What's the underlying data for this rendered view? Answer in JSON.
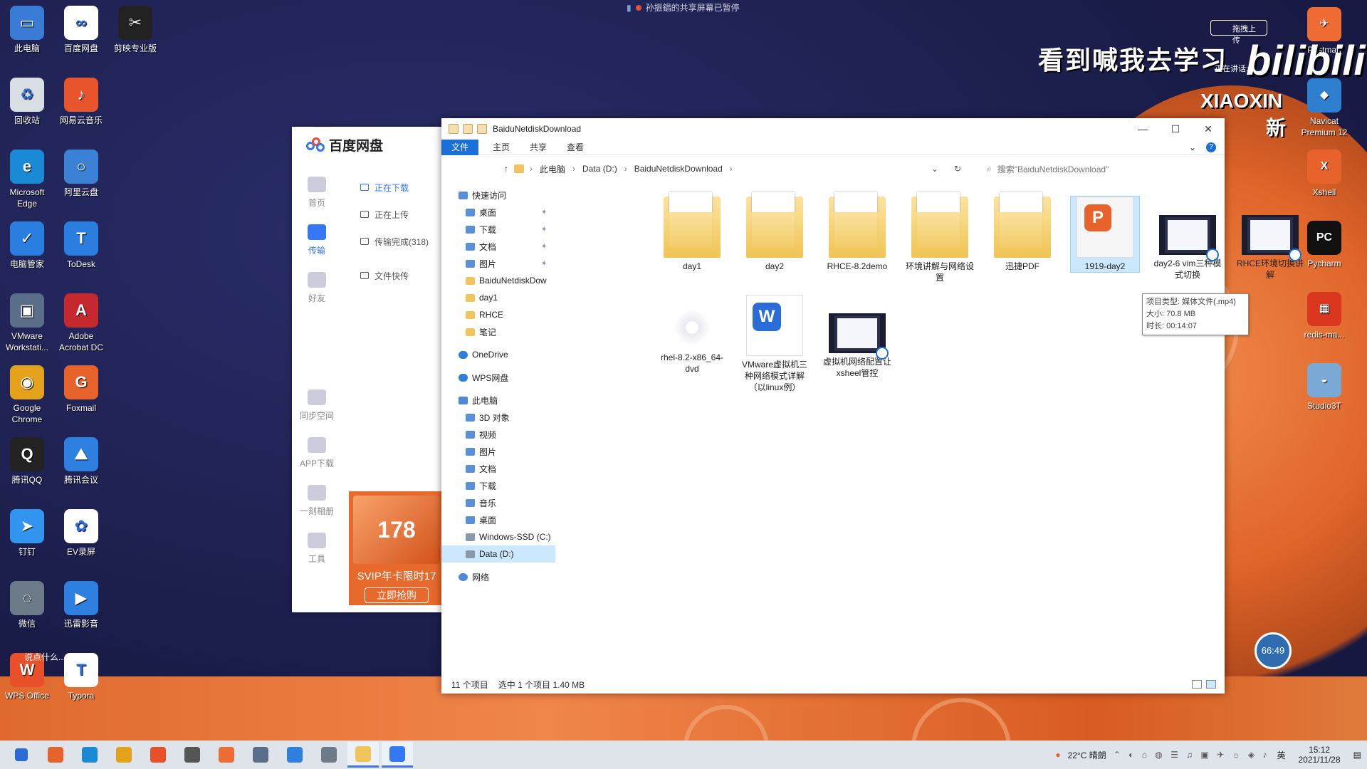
{
  "top_note": "孙振錩的共享屏幕已暂停",
  "overlay": {
    "slogan": "看到喊我去学习",
    "brand": "bilibili",
    "brand_line2": "XIAOXIN",
    "brand_line3": "新",
    "talking": "正在讲话:",
    "upload_chip": "拖拽上传",
    "timer": "66:49",
    "chat_hint": "说点什么..."
  },
  "desktop_icons": [
    {
      "label": "此电脑",
      "color": "#3a7bd5",
      "glyph": "▭"
    },
    {
      "label": "百度网盘",
      "color": "#ffffff",
      "glyph": "∞"
    },
    {
      "label": "剪映专业版",
      "color": "#222222",
      "glyph": "✂"
    },
    {
      "label": "回收站",
      "color": "#d9dde4",
      "glyph": "♻"
    },
    {
      "label": "网易云音乐",
      "color": "#e8542c",
      "glyph": "♪"
    },
    {
      "label": "Microsoft Edge",
      "color": "#1b8ad6",
      "glyph": "e"
    },
    {
      "label": "阿里云盘",
      "color": "#3b82d6",
      "glyph": "○"
    },
    {
      "label": "电脑管家",
      "color": "#2a7ee0",
      "glyph": "✓"
    },
    {
      "label": "ToDesk",
      "color": "#2a7ee0",
      "glyph": "T"
    },
    {
      "label": "VMware Workstati...",
      "color": "#5a6e8a",
      "glyph": "▣"
    },
    {
      "label": "Adobe Acrobat DC",
      "color": "#c5282e",
      "glyph": "A"
    },
    {
      "label": "Google Chrome",
      "color": "#e3a21a",
      "glyph": "◉"
    },
    {
      "label": "Foxmail",
      "color": "#e8632c",
      "glyph": "G"
    },
    {
      "label": "腾讯QQ",
      "color": "#222222",
      "glyph": "Q"
    },
    {
      "label": "腾讯会议",
      "color": "#2d7fe0",
      "glyph": "⛰"
    },
    {
      "label": "钉钉",
      "color": "#3296f0",
      "glyph": "➤"
    },
    {
      "label": "EV录屏",
      "color": "#ffffff",
      "glyph": "✿"
    },
    {
      "label": "微信",
      "color": "#6c7a8a",
      "glyph": "◌"
    },
    {
      "label": "迅雷影音",
      "color": "#2d7fe0",
      "glyph": "▶"
    },
    {
      "label": "WPS Office",
      "color": "#e8502a",
      "glyph": "W"
    },
    {
      "label": "Typora",
      "color": "#ffffff",
      "glyph": "T"
    }
  ],
  "right_icons": [
    {
      "label": "Postman",
      "color": "#ef6c35",
      "glyph": "✈"
    },
    {
      "label": "Navicat Premium 12",
      "color": "#2f7fd0",
      "glyph": "◆"
    },
    {
      "label": "Xshell",
      "color": "#e8632c",
      "glyph": "X"
    },
    {
      "label": "Pycharm",
      "color": "#111111",
      "glyph": "PC"
    },
    {
      "label": "redis-ma...",
      "color": "#d9371e",
      "glyph": "▦"
    },
    {
      "label": "Studio3T",
      "color": "#7aa9d6",
      "glyph": "◒"
    }
  ],
  "baidu": {
    "title": "百度网盘",
    "nav": [
      {
        "label": "首页"
      },
      {
        "label": "传输"
      },
      {
        "label": "好友"
      },
      {
        "label": "同步空间"
      },
      {
        "label": "APP下载"
      },
      {
        "label": "一刻相册"
      },
      {
        "label": "工具"
      }
    ],
    "sub": [
      {
        "label": "正在下载"
      },
      {
        "label": "正在上传"
      },
      {
        "label": "传输完成(318)"
      },
      {
        "label": "文件快传"
      }
    ],
    "promo_art": "178",
    "promo_text": "SVIP年卡限时17",
    "promo_button": "立即抢购"
  },
  "explorer": {
    "title": "BaiduNetdiskDownload",
    "window_controls": {
      "minimize": "—",
      "maximize": "☐",
      "close": "✕"
    },
    "ribbon_tabs": [
      "文件",
      "主页",
      "共享",
      "查看"
    ],
    "address": [
      "此电脑",
      "Data (D:)",
      "BaiduNetdiskDownload"
    ],
    "search_placeholder": "搜索\"BaiduNetdiskDownload\"",
    "nav_items": [
      {
        "label": "快速访问",
        "level": 1,
        "icon": "star",
        "pin": false
      },
      {
        "label": "桌面",
        "level": 2,
        "icon": "desktop",
        "pin": true
      },
      {
        "label": "下载",
        "level": 2,
        "icon": "download",
        "pin": true
      },
      {
        "label": "文档",
        "level": 2,
        "icon": "doc",
        "pin": true
      },
      {
        "label": "图片",
        "level": 2,
        "icon": "pic",
        "pin": true
      },
      {
        "label": "BaiduNetdiskDow",
        "level": 2,
        "icon": "folder",
        "pin": false
      },
      {
        "label": "day1",
        "level": 2,
        "icon": "folder",
        "pin": false
      },
      {
        "label": "RHCE",
        "level": 2,
        "icon": "folder",
        "pin": false
      },
      {
        "label": "笔记",
        "level": 2,
        "icon": "folder",
        "pin": false
      },
      {
        "label": "OneDrive",
        "level": 1,
        "icon": "cloud",
        "pin": false
      },
      {
        "label": "WPS网盘",
        "level": 1,
        "icon": "cloud",
        "pin": false
      },
      {
        "label": "此电脑",
        "level": 1,
        "icon": "pc",
        "pin": false
      },
      {
        "label": "3D 对象",
        "level": 2,
        "icon": "cube",
        "pin": false
      },
      {
        "label": "视频",
        "level": 2,
        "icon": "video",
        "pin": false
      },
      {
        "label": "图片",
        "level": 2,
        "icon": "pic",
        "pin": false
      },
      {
        "label": "文档",
        "level": 2,
        "icon": "doc",
        "pin": false
      },
      {
        "label": "下载",
        "level": 2,
        "icon": "download",
        "pin": false
      },
      {
        "label": "音乐",
        "level": 2,
        "icon": "music",
        "pin": false
      },
      {
        "label": "桌面",
        "level": 2,
        "icon": "desktop",
        "pin": false
      },
      {
        "label": "Windows-SSD (C:)",
        "level": 2,
        "icon": "drive",
        "pin": false
      },
      {
        "label": "Data (D:)",
        "level": 2,
        "icon": "drive",
        "pin": false,
        "selected": true
      },
      {
        "label": "网络",
        "level": 1,
        "icon": "net",
        "pin": false
      }
    ],
    "files": [
      {
        "name": "day1",
        "type": "folder"
      },
      {
        "name": "day2",
        "type": "folder"
      },
      {
        "name": "RHCE-8.2demo",
        "type": "folder"
      },
      {
        "name": "环境讲解与网络设置",
        "type": "folder"
      },
      {
        "name": "迅捷PDF",
        "type": "folder"
      },
      {
        "name": "1919-day2",
        "type": "ppt",
        "selected": true
      },
      {
        "name": "day2-6 vim三种模式切换",
        "type": "video"
      },
      {
        "name": "RHCE环境切换讲解",
        "type": "video"
      },
      {
        "name": "rhel-8.2-x86_64-dvd",
        "type": "disc"
      },
      {
        "name": "VMware虚拟机三种网络模式详解（以linux例）",
        "type": "word"
      },
      {
        "name": "虚拟机网络配置让xsheel管控",
        "type": "video"
      }
    ],
    "tooltip": {
      "line1": "项目类型: 媒体文件(.mp4)",
      "line2": "大小: 70.8 MB",
      "line3": "时长: 00:14:07"
    },
    "status": {
      "count": "11 个项目",
      "selection": "选中 1 个项目  1.40 MB"
    }
  },
  "taskbar": {
    "weather": "22°C 晴朗",
    "time": "15:12",
    "date": "2021/11/28",
    "ime": "英",
    "apps": [
      "start",
      "search",
      "edge",
      "chrome",
      "wps",
      "typora",
      "postman",
      "vmware",
      "tencent-meeting",
      "wechat",
      "explorer",
      "baidu-netdisk"
    ]
  }
}
